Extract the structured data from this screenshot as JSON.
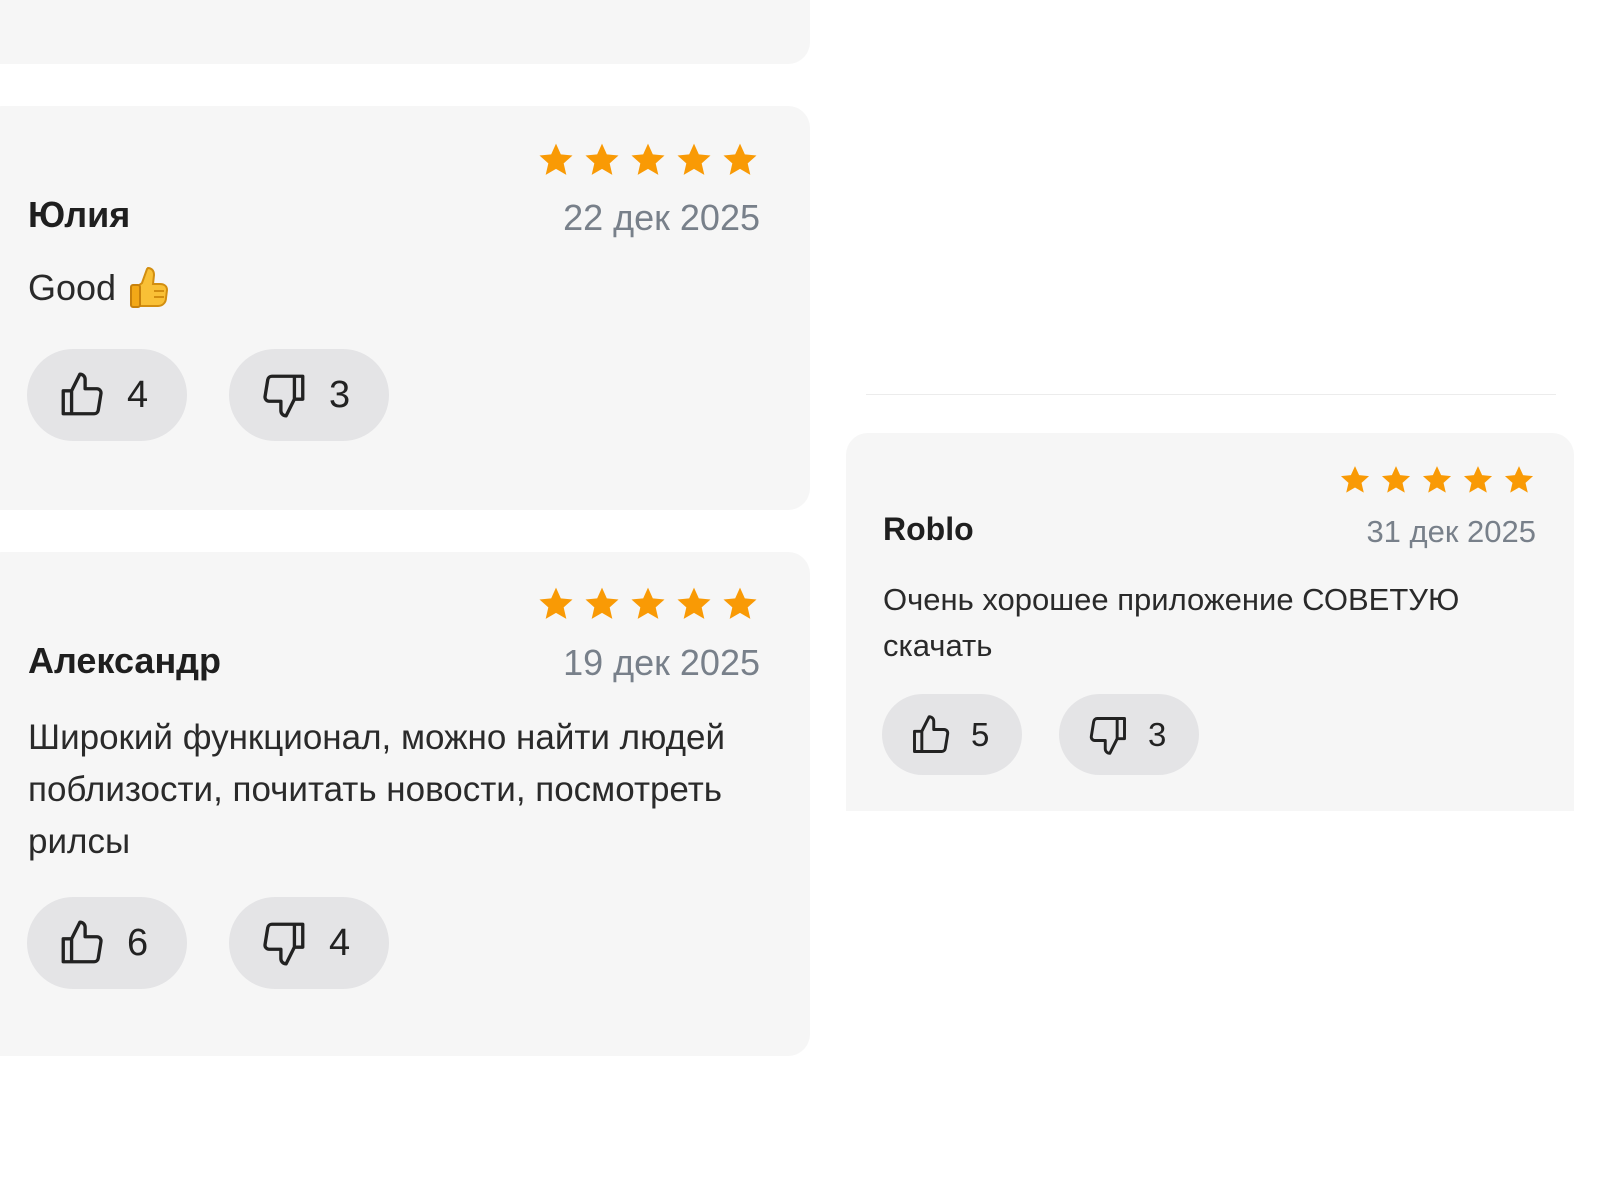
{
  "colors": {
    "card_bg": "#f6f6f6",
    "star": "#f99a05",
    "date": "#78808a",
    "vote_bg": "#e4e4e6"
  },
  "reviews": [
    {
      "author": "Юлия",
      "date": "22 дек 2025",
      "rating": 5,
      "text": "Good",
      "text_emoji": "thumbs-up-emoji",
      "likes": "4",
      "dislikes": "3"
    },
    {
      "author": "Александр",
      "date": "19 дек 2025",
      "rating": 5,
      "text": "Широкий функционал, можно найти людей поблизости, почитать новости, посмотреть рилсы",
      "likes": "6",
      "dislikes": "4"
    },
    {
      "author": "Roblo",
      "date": "31 дек 2025",
      "rating": 5,
      "text": "Очень хорошее приложение СОВЕТУЮ скачать",
      "likes": "5",
      "dislikes": "3"
    }
  ],
  "icons": {
    "like": "thumb-up-outline-icon",
    "dislike": "thumb-down-outline-icon",
    "star": "star-icon"
  }
}
